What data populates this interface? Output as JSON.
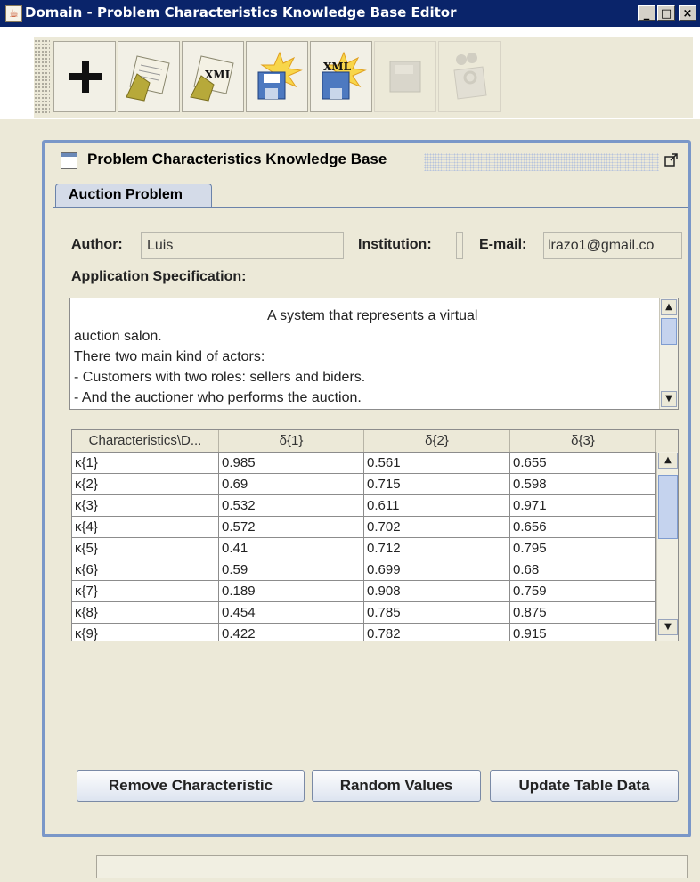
{
  "window": {
    "title": "Domain - Problem Characteristics Knowledge Base Editor",
    "minimize_label": "_",
    "maximize_label": "□",
    "close_label": "×"
  },
  "toolbar": {
    "buttons": [
      {
        "name": "new-button",
        "icon": "plus-icon",
        "enabled": true
      },
      {
        "name": "open-button",
        "icon": "open-document-icon",
        "enabled": true
      },
      {
        "name": "open-xml-button",
        "icon": "xml-document-icon",
        "enabled": true,
        "badge": "XML"
      },
      {
        "name": "save-button",
        "icon": "save-icon",
        "enabled": true
      },
      {
        "name": "save-xml-button",
        "icon": "save-xml-icon",
        "enabled": true,
        "badge": "XML"
      },
      {
        "name": "disabled-button-1",
        "icon": "floppy-icon",
        "enabled": false
      },
      {
        "name": "disabled-button-2",
        "icon": "settings-document-icon",
        "enabled": false
      }
    ]
  },
  "frame": {
    "title": "Problem Characteristics Knowledge Base",
    "tab_label": "Auction Problem"
  },
  "form": {
    "author_label": "Author:",
    "author_value": "Luis",
    "institution_label": "Institution:",
    "institution_value": "",
    "email_label": "E-mail:",
    "email_value": "lrazo1@gmail.co",
    "spec_label": "Application Specification:",
    "spec_text": "                                                 A system that represents a virtual\nauction salon.\nThere two main kind of actors:\n- Customers with two roles: sellers and biders.\n- And the auctioner who performs the auction."
  },
  "table": {
    "columns": [
      "Characteristics\\D...",
      "δ{1}",
      "δ{2}",
      "δ{3}"
    ],
    "rows": [
      [
        "κ{1}",
        "0.985",
        "0.561",
        "0.655"
      ],
      [
        "κ{2}",
        "0.69",
        "0.715",
        "0.598"
      ],
      [
        "κ{3}",
        "0.532",
        "0.611",
        "0.971"
      ],
      [
        "κ{4}",
        "0.572",
        "0.702",
        "0.656"
      ],
      [
        "κ{5}",
        "0.41",
        "0.712",
        "0.795"
      ],
      [
        "κ{6}",
        "0.59",
        "0.699",
        "0.68"
      ],
      [
        "κ{7}",
        "0.189",
        "0.908",
        "0.759"
      ],
      [
        "κ{8}",
        "0.454",
        "0.785",
        "0.875"
      ],
      [
        "κ{9}",
        "0.422",
        "0.782",
        "0.915"
      ]
    ]
  },
  "buttons": {
    "remove_label": "Remove Characteristic",
    "random_label": "Random Values",
    "update_label": "Update Table Data"
  },
  "status": {
    "text": ""
  },
  "colors": {
    "titlebar": "#0a246a",
    "frame_border": "#7a97c8",
    "panel_bg": "#ece9d8"
  }
}
